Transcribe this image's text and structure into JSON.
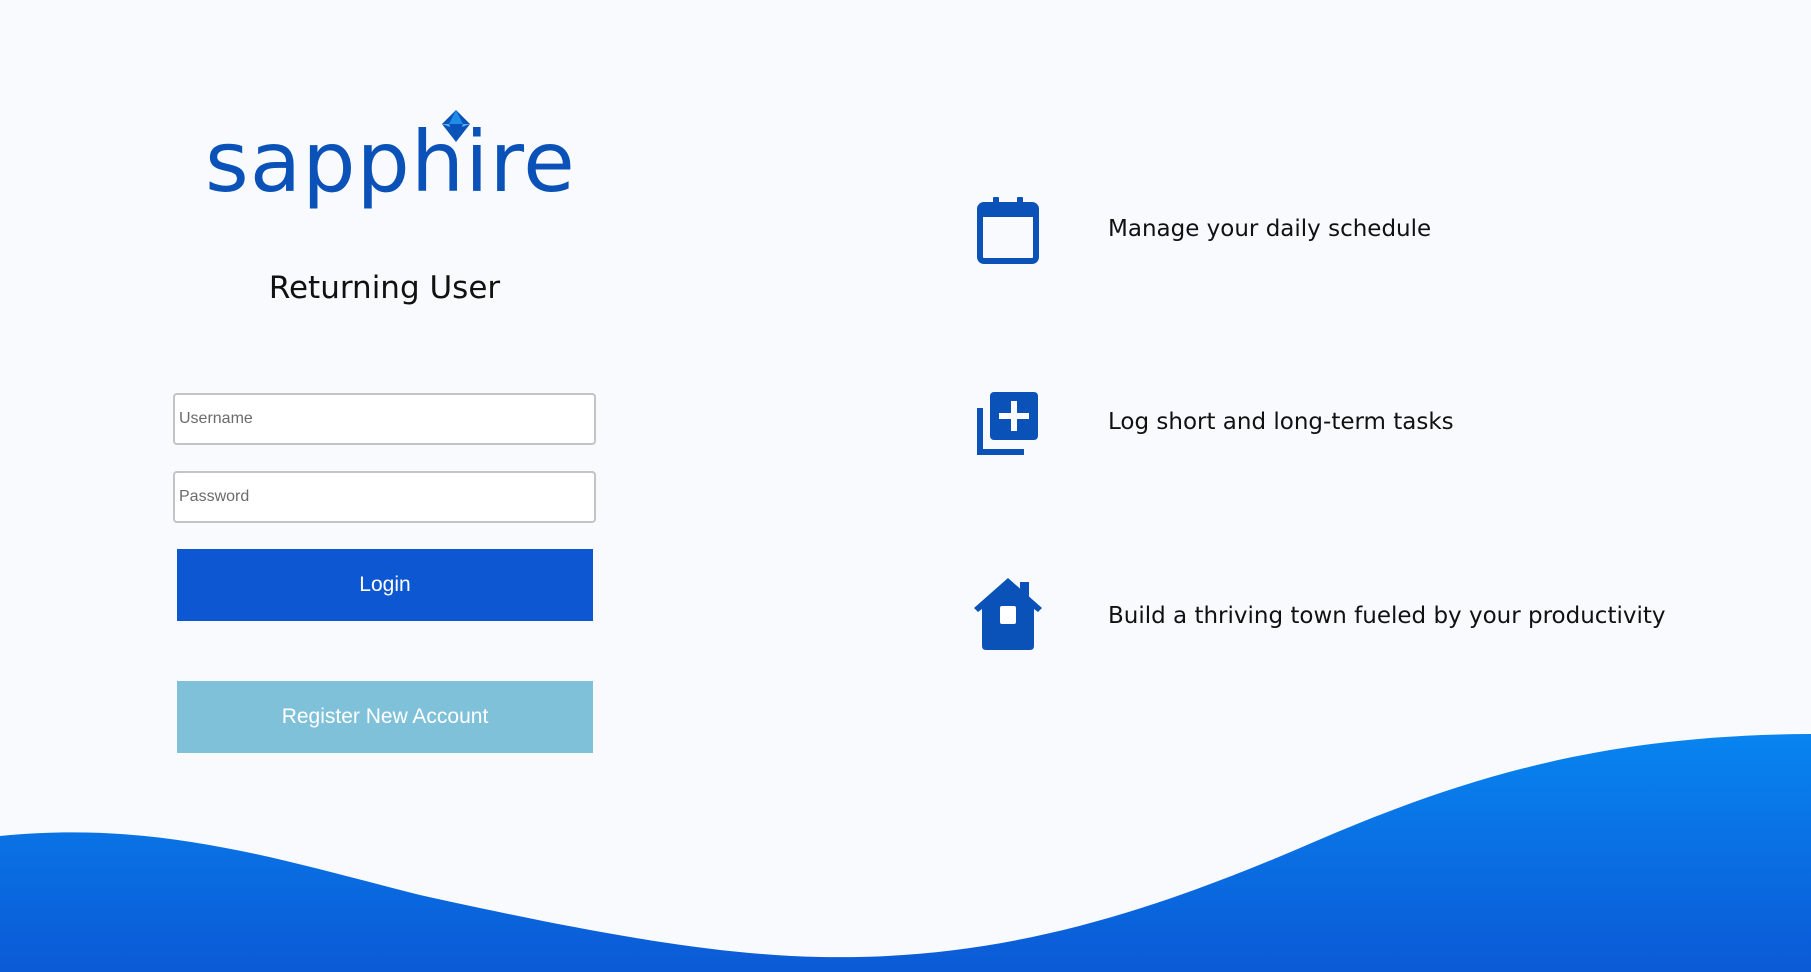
{
  "brand": {
    "logo_text": "sapphire",
    "logo_color": "#0a52b8"
  },
  "login": {
    "heading": "Returning User",
    "username_placeholder": "Username",
    "password_placeholder": "Password",
    "login_label": "Login",
    "register_label": "Register New Account"
  },
  "features": [
    {
      "icon": "calendar-icon",
      "text": "Manage your daily schedule"
    },
    {
      "icon": "add-task-icon",
      "text": "Log short and long-term tasks"
    },
    {
      "icon": "house-icon",
      "text": "Build a thriving town fueled by your productivity"
    }
  ],
  "colors": {
    "background": "#f8fafd",
    "primary": "#0d58d2",
    "secondary": "#80c1da",
    "wave_top": "#0884f0",
    "wave_bottom": "#0b5ad6"
  }
}
